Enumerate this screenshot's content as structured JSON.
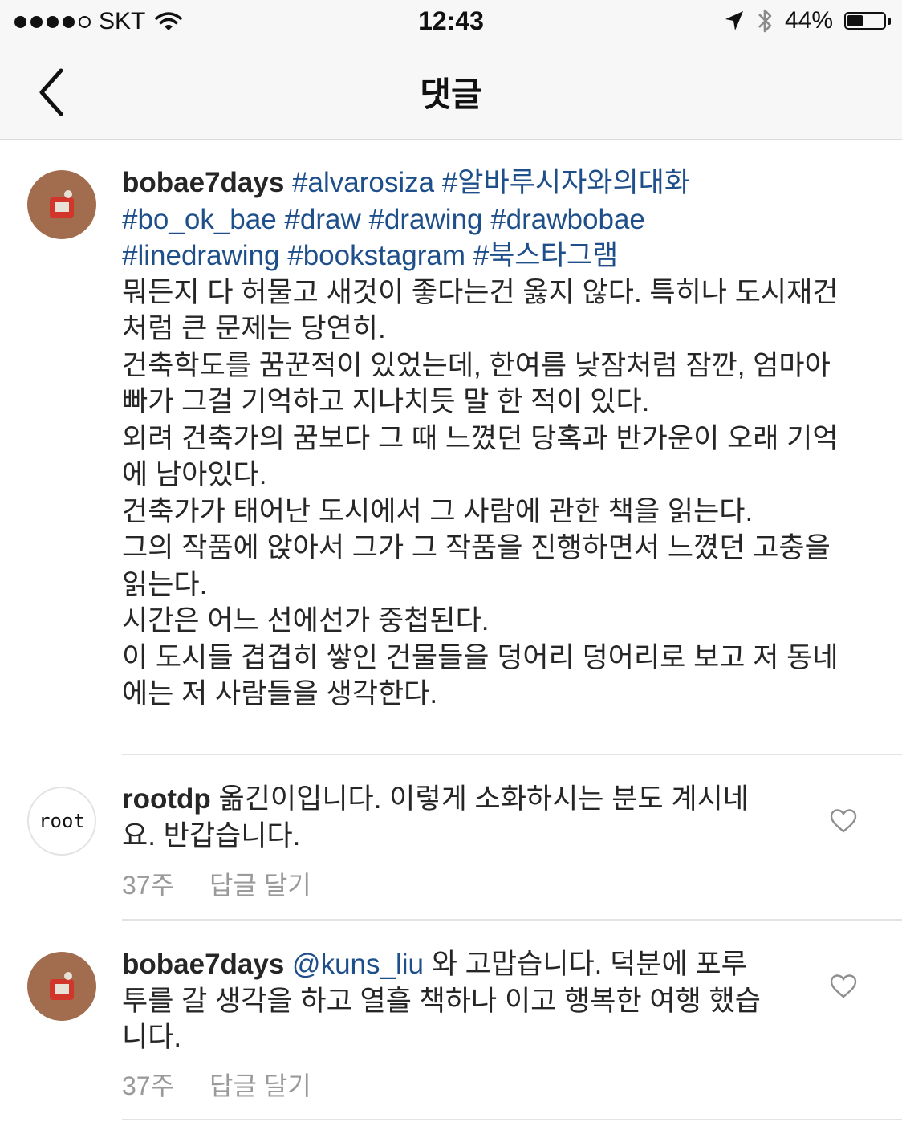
{
  "status_bar": {
    "carrier": "SKT",
    "time": "12:43",
    "battery": "44%",
    "battery_level": 0.44
  },
  "nav": {
    "title": "댓글"
  },
  "caption": {
    "username": "bobae7days",
    "hashtags_line1": "#alvarosiza #알바루시자와의대화",
    "hashtags_line2": "#bo_ok_bae #draw #drawing #drawbobae",
    "hashtags_line3": "#linedrawing #bookstagram #북스타그램",
    "body": [
      "뭐든지 다 허물고 새것이 좋다는건 옳지 않다. 특히나 도시재건",
      "처럼 큰 문제는 당연히.",
      "건축학도를 꿈꾼적이 있었는데, 한여름 낮잠처럼 잠깐, 엄마아",
      "빠가 그걸 기억하고 지나치듯 말 한 적이 있다.",
      "외려 건축가의 꿈보다 그 때 느꼈던 당혹과 반가운이 오래 기억",
      "에 남아있다.",
      "건축가가 태어난 도시에서 그 사람에 관한 책을 읽는다.",
      "그의 작품에 앉아서 그가 그 작품을 진행하면서 느꼈던 고충을",
      "읽는다.",
      "시간은 어느 선에선가 중첩된다.",
      "이 도시들 겹겹히 쌓인 건물들을 덩어리 덩어리로 보고 저 동네",
      "에는 저 사람들을 생각한다."
    ]
  },
  "comments": [
    {
      "username": "rootdp",
      "avatar_text": "root",
      "line1": "옮긴이입니다. 이렇게 소화하시는 분도 계시네",
      "line2": "요. 반갑습니다.",
      "time": "37주",
      "reply": "답글 달기"
    },
    {
      "username": "bobae7days",
      "mention": "@kuns_liu",
      "line1": "와 고맙습니다. 덕분에 포루",
      "line2": "투를 갈 생각을 하고 열흘 책하나 이고 행복한 여행 했습",
      "line3": "니다.",
      "time": "37주",
      "reply": "답글 달기"
    }
  ],
  "colors": {
    "hashtag": "#1e4f8a",
    "meta": "#9a9a9a",
    "bar_bg": "#f7f7f7",
    "avatar_brown": "#a26d4e"
  },
  "icons": [
    "signal-dots-icon",
    "wifi-icon",
    "location-arrow-icon",
    "bluetooth-icon",
    "battery-icon",
    "back-chevron-icon",
    "heart-icon"
  ]
}
